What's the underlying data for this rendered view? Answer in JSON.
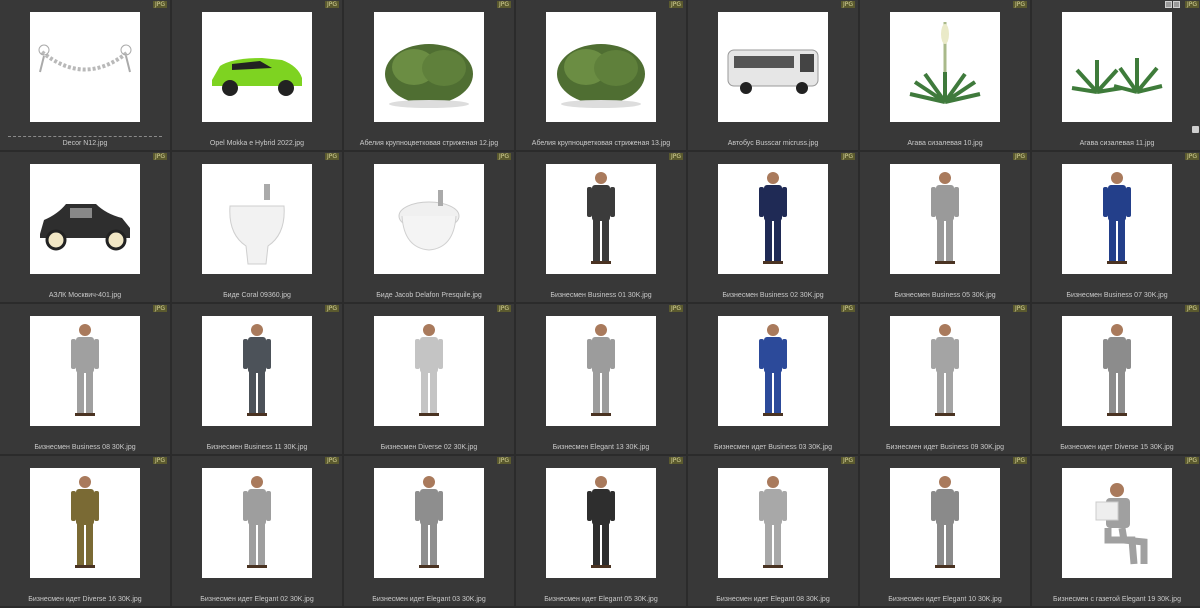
{
  "badge_label": "JPG",
  "items": [
    {
      "name": "Decor N12.jpg",
      "icon": "garland"
    },
    {
      "name": "Opel Mokka e Hybrid 2022.jpg",
      "icon": "car-green"
    },
    {
      "name": "Абелия крупноцветковая стриженая 12.jpg",
      "icon": "bush"
    },
    {
      "name": "Абелия крупноцветковая стриженая 13.jpg",
      "icon": "bush"
    },
    {
      "name": "Автобус Busscar micruss.jpg",
      "icon": "bus"
    },
    {
      "name": "Агава сизалевая 10.jpg",
      "icon": "agave-tall"
    },
    {
      "name": "Агава сизалевая 11.jpg",
      "icon": "agave"
    },
    {
      "name": "АЗЛК Москвич-401.jpg",
      "icon": "car-vintage"
    },
    {
      "name": "Биде Coral 09360.jpg",
      "icon": "bidet"
    },
    {
      "name": "Биде Jacob Delafon Presquile.jpg",
      "icon": "bidet2"
    },
    {
      "name": "Бизнесмен Business 01 30K.jpg",
      "icon": "person",
      "suit": "#3b3b3b"
    },
    {
      "name": "Бизнесмен Business 02 30K.jpg",
      "icon": "person",
      "suit": "#1f2a55"
    },
    {
      "name": "Бизнесмен Business 05 30K.jpg",
      "icon": "person",
      "suit": "#9a9a9a"
    },
    {
      "name": "Бизнесмен Business 07 30K.jpg",
      "icon": "person",
      "suit": "#233f8a"
    },
    {
      "name": "Бизнесмен Business 08 30K.jpg",
      "icon": "person",
      "suit": "#a0a0a0"
    },
    {
      "name": "Бизнесмен Business 11 30K.jpg",
      "icon": "person",
      "suit": "#4c5259"
    },
    {
      "name": "Бизнесмен Diverse 02 30K.jpg",
      "icon": "person",
      "suit": "#c4c4c4"
    },
    {
      "name": "Бизнесмен Elegant 13 30K.jpg",
      "icon": "person",
      "suit": "#9c9c9c"
    },
    {
      "name": "Бизнесмен идет Business 03 30K.jpg",
      "icon": "person",
      "suit": "#2c4a9a"
    },
    {
      "name": "Бизнесмен идет Business 09 30K.jpg",
      "icon": "person",
      "suit": "#a4a4a4"
    },
    {
      "name": "Бизнесмен идет Diverse 15 30K.jpg",
      "icon": "person",
      "suit": "#8c8c8c"
    },
    {
      "name": "Бизнесмен идет Diverse 16 30K.jpg",
      "icon": "person",
      "suit": "#7a6a34"
    },
    {
      "name": "Бизнесмен идет Elegant 02 30K.jpg",
      "icon": "person",
      "suit": "#9e9e9e"
    },
    {
      "name": "Бизнесмен идет Elegant 03 30K.jpg",
      "icon": "person",
      "suit": "#8e8e8e"
    },
    {
      "name": "Бизнесмен идет Elegant 05 30K.jpg",
      "icon": "person",
      "suit": "#2e2e2e"
    },
    {
      "name": "Бизнесмен идет Elegant 08 30K.jpg",
      "icon": "person",
      "suit": "#a8a8a8"
    },
    {
      "name": "Бизнесмен идет Elegant 10 30K.jpg",
      "icon": "person",
      "suit": "#8a8a8a"
    },
    {
      "name": "Бизнесмен с газетой Elegant 19 30K.jpg",
      "icon": "person-sitting",
      "suit": "#a0a0a0"
    }
  ]
}
